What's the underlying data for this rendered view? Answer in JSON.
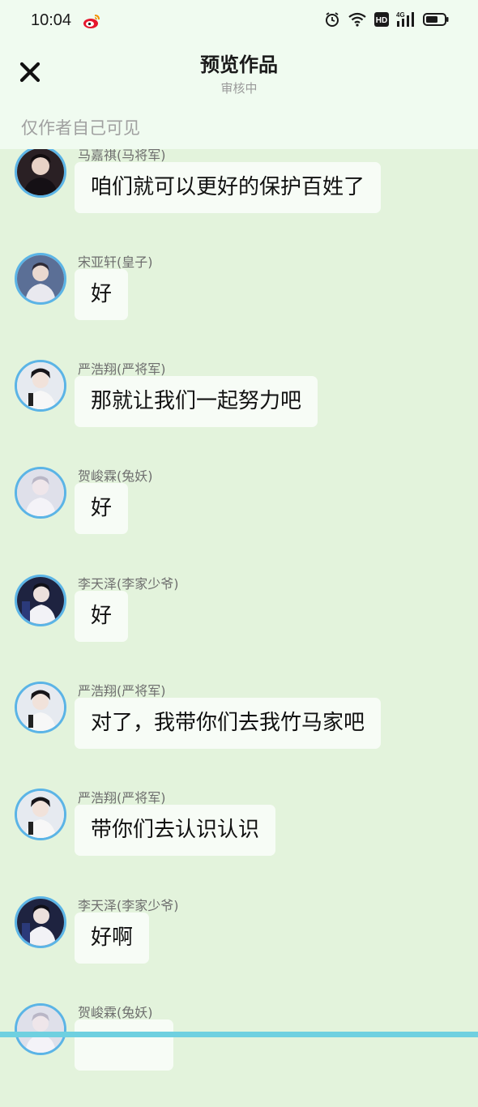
{
  "status_bar": {
    "time": "10:04",
    "hd_badge": "HD",
    "network_label": "4G",
    "icons": [
      "weibo-icon",
      "alarm-icon",
      "wifi-icon",
      "hd-icon",
      "signal-icon",
      "battery-icon"
    ]
  },
  "header": {
    "close_icon": "close-icon",
    "title": "预览作品",
    "subtitle": "审核中",
    "visibility_note": "仅作者自己可见"
  },
  "colors": {
    "background": "#e3f3dc",
    "header_bg": "#f0fbf0",
    "bubble_bg": "#f7fcf6",
    "avatar_ring": "#5bb4e6"
  },
  "messages": [
    {
      "name": "马嘉祺(马将军)",
      "text": "咱们就可以更好的保护百姓了"
    },
    {
      "name": "宋亚轩(皇子)",
      "text": "好"
    },
    {
      "name": "严浩翔(严将军)",
      "text": "那就让我们一起努力吧"
    },
    {
      "name": "贺峻霖(兔妖)",
      "text": "好"
    },
    {
      "name": "李天泽(李家少爷)",
      "text": "好"
    },
    {
      "name": "严浩翔(严将军)",
      "text": "对了，我带你们去我竹马家吧"
    },
    {
      "name": "严浩翔(严将军)",
      "text": "带你们去认识认识"
    },
    {
      "name": "李天泽(李家少爷)",
      "text": "好啊"
    },
    {
      "name": "贺峻霖(兔妖)",
      "text": ""
    }
  ]
}
